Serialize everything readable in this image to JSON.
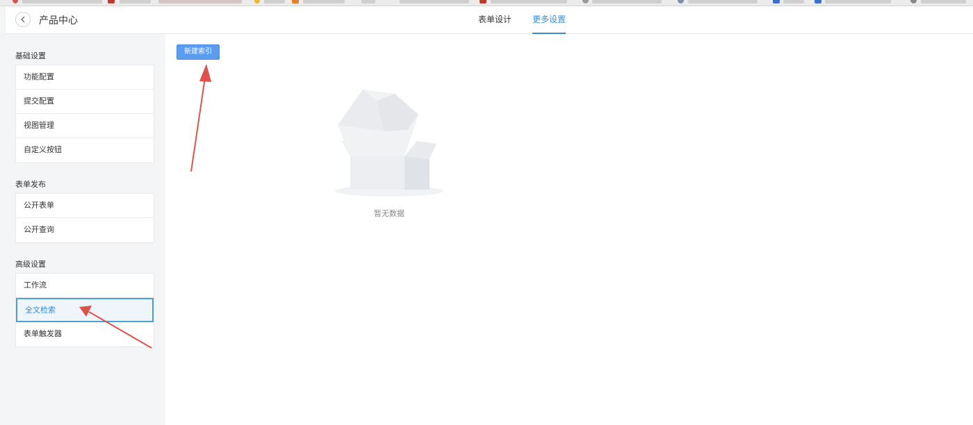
{
  "header": {
    "title": "产品中心",
    "tabs": [
      {
        "label": "表单设计",
        "active": false
      },
      {
        "label": "更多设置",
        "active": true
      }
    ]
  },
  "sidebar": {
    "sections": [
      {
        "title": "基础设置",
        "items": [
          {
            "label": "功能配置"
          },
          {
            "label": "提交配置"
          },
          {
            "label": "视图管理"
          },
          {
            "label": "自定义按钮"
          }
        ]
      },
      {
        "title": "表单发布",
        "items": [
          {
            "label": "公开表单"
          },
          {
            "label": "公开查询"
          }
        ]
      },
      {
        "title": "高级设置",
        "items": [
          {
            "label": "工作流"
          },
          {
            "label": "全文检索",
            "active": true
          },
          {
            "label": "表单触发器"
          }
        ]
      }
    ]
  },
  "main": {
    "new_index_button": "新建索引",
    "empty_text": "暂无数据"
  },
  "colors": {
    "accent": "#3a8bd6",
    "button": "#5a9cf2",
    "annotation_arrow": "#e2504a"
  }
}
